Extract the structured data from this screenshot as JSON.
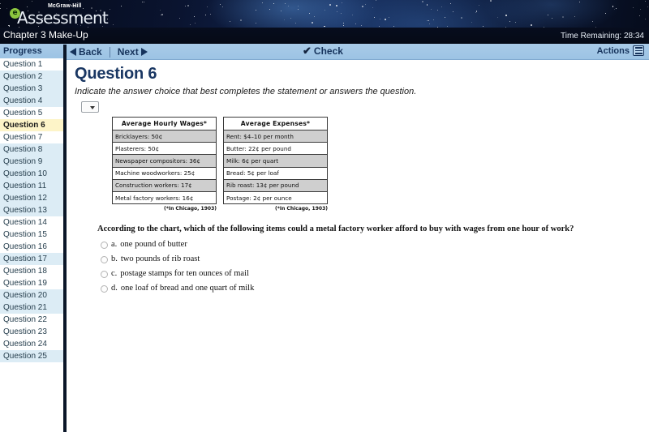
{
  "header": {
    "logo_sup": "McGraw-Hill",
    "logo_e": "e",
    "logo_main": "Assessment",
    "chapter_title": "Chapter 3 Make-Up",
    "time_remaining": "Time Remaining: 28:34"
  },
  "navbar": {
    "back_label": "Back",
    "next_label": "Next",
    "check_label": "Check",
    "check_icon": "checkmark-icon",
    "actions_label": "Actions",
    "actions_icon": "hamburger-menu-icon"
  },
  "sidebar": {
    "heading": "Progress",
    "items": [
      {
        "label": "Question 1",
        "shade": false,
        "current": false
      },
      {
        "label": "Question 2",
        "shade": true,
        "current": false
      },
      {
        "label": "Question 3",
        "shade": true,
        "current": false
      },
      {
        "label": "Question 4",
        "shade": true,
        "current": false
      },
      {
        "label": "Question 5",
        "shade": false,
        "current": false
      },
      {
        "label": "Question 6",
        "shade": false,
        "current": true
      },
      {
        "label": "Question 7",
        "shade": false,
        "current": false
      },
      {
        "label": "Question 8",
        "shade": true,
        "current": false
      },
      {
        "label": "Question 9",
        "shade": true,
        "current": false
      },
      {
        "label": "Question 10",
        "shade": true,
        "current": false
      },
      {
        "label": "Question 11",
        "shade": true,
        "current": false
      },
      {
        "label": "Question 12",
        "shade": true,
        "current": false
      },
      {
        "label": "Question 13",
        "shade": true,
        "current": false
      },
      {
        "label": "Question 14",
        "shade": false,
        "current": false
      },
      {
        "label": "Question 15",
        "shade": false,
        "current": false
      },
      {
        "label": "Question 16",
        "shade": false,
        "current": false
      },
      {
        "label": "Question 17",
        "shade": true,
        "current": false
      },
      {
        "label": "Question 18",
        "shade": false,
        "current": false
      },
      {
        "label": "Question 19",
        "shade": false,
        "current": false
      },
      {
        "label": "Question 20",
        "shade": true,
        "current": false
      },
      {
        "label": "Question 21",
        "shade": true,
        "current": false
      },
      {
        "label": "Question 22",
        "shade": false,
        "current": false
      },
      {
        "label": "Question 23",
        "shade": false,
        "current": false
      },
      {
        "label": "Question 24",
        "shade": false,
        "current": false
      },
      {
        "label": "Question 25",
        "shade": true,
        "current": false
      }
    ]
  },
  "main": {
    "question_title": "Question 6",
    "instructions": "Indicate the answer choice that best completes the statement or answers the question.",
    "selector_value": "",
    "question_stem": "According to the chart, which of the following items could a metal factory worker afford to buy with wages from one hour of work?",
    "choices": [
      {
        "letter": "a.",
        "text": "one pound of butter",
        "selected": false
      },
      {
        "letter": "b.",
        "text": "two pounds of rib roast",
        "selected": false
      },
      {
        "letter": "c.",
        "text": "postage stamps for ten ounces of mail",
        "selected": false
      },
      {
        "letter": "d.",
        "text": "one loaf of bread and one quart of milk",
        "selected": false
      }
    ]
  },
  "chart_data": [
    {
      "type": "table",
      "title": "Average Hourly Wages*",
      "note": "(*In Chicago, 1903)",
      "categories": [
        "Bricklayers",
        "Plasterers",
        "Newspaper compositors",
        "Machine woodworkers",
        "Construction workers",
        "Metal factory workers"
      ],
      "values": [
        50,
        50,
        36,
        25,
        17,
        16
      ],
      "unit": "cents per hour",
      "rows": [
        "Bricklayers: 50¢",
        "Plasterers: 50¢",
        "Newspaper compositors: 36¢",
        "Machine woodworkers: 25¢",
        "Construction workers: 17¢",
        "Metal factory workers: 16¢"
      ]
    },
    {
      "type": "table",
      "title": "Average Expenses*",
      "note": "(*In Chicago, 1903)",
      "categories": [
        "Rent",
        "Butter",
        "Milk",
        "Bread",
        "Rib roast",
        "Postage"
      ],
      "values": [
        "$4-10 per month",
        "22¢ per pound",
        "6¢ per quart",
        "5¢ per loaf",
        "13¢ per pound",
        "2¢ per ounce"
      ],
      "rows": [
        "Rent: $4–10 per month",
        "Butter: 22¢ per pound",
        "Milk: 6¢ per quart",
        "Bread: 5¢ per loaf",
        "Rib roast: 13¢ per pound",
        "Postage: 2¢ per ounce"
      ]
    }
  ],
  "colors": {
    "nav_blue": "#9cc3e4",
    "title_navy": "#1a3763",
    "current_row": "#fdf4c8",
    "row_shade": "#dcecf5",
    "table_alt": "#cfcfcf",
    "logo_green": "#8cc63f"
  }
}
